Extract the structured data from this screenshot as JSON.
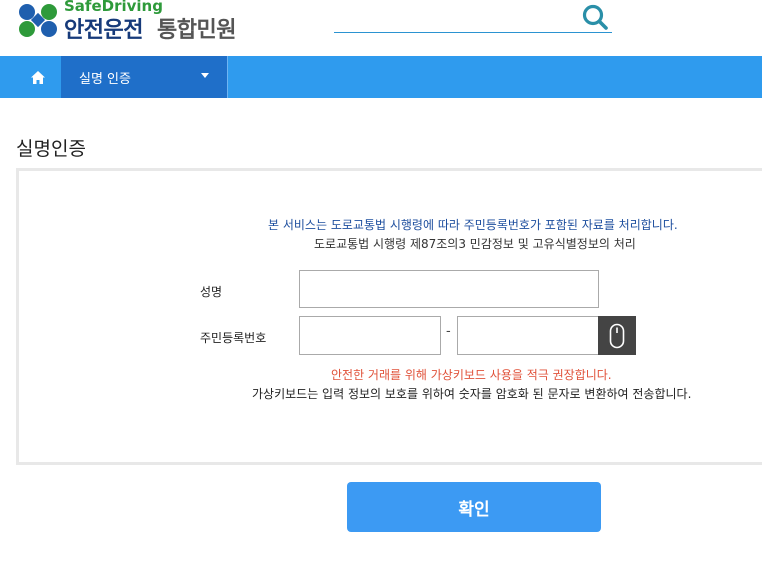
{
  "header": {
    "logo_subtitle": "SafeDriving",
    "logo_title": "안전운전",
    "logo_title_tail": "통합민원",
    "search": {
      "value": "",
      "placeholder": ""
    }
  },
  "nav": {
    "home_icon": "home-icon",
    "menu_label": "실명 인증",
    "colors": {
      "bar": "#2f9bee",
      "active_menu": "#1f6fc9"
    }
  },
  "page": {
    "title": "실명인증"
  },
  "notice": {
    "service_notice": "본 서비스는 도로교통법 시행령에 따라 주민등록번호가 포함된 자료를 처리합니다.",
    "law_reference": "도로교통법 시행령 제87조의3 민감정보 및 고유식별정보의 처리"
  },
  "form": {
    "name_label": "성명",
    "name_value": "",
    "rrn_label": "주민등록번호",
    "rrn_front_value": "",
    "rrn_separator": "-",
    "rrn_back_value": "",
    "virtual_keyboard_icon": "mouse-icon"
  },
  "virtual_keyboard": {
    "recommendation": "안전한 거래를 위해 가상키보드 사용을 적극 권장합니다.",
    "description": "가상키보드는 입력 정보의 보호를 위하여 숫자를 암호화 된 문자로 변환하여 전송합니다."
  },
  "actions": {
    "confirm_label": "확인",
    "confirm_color": "#3c9af3"
  }
}
